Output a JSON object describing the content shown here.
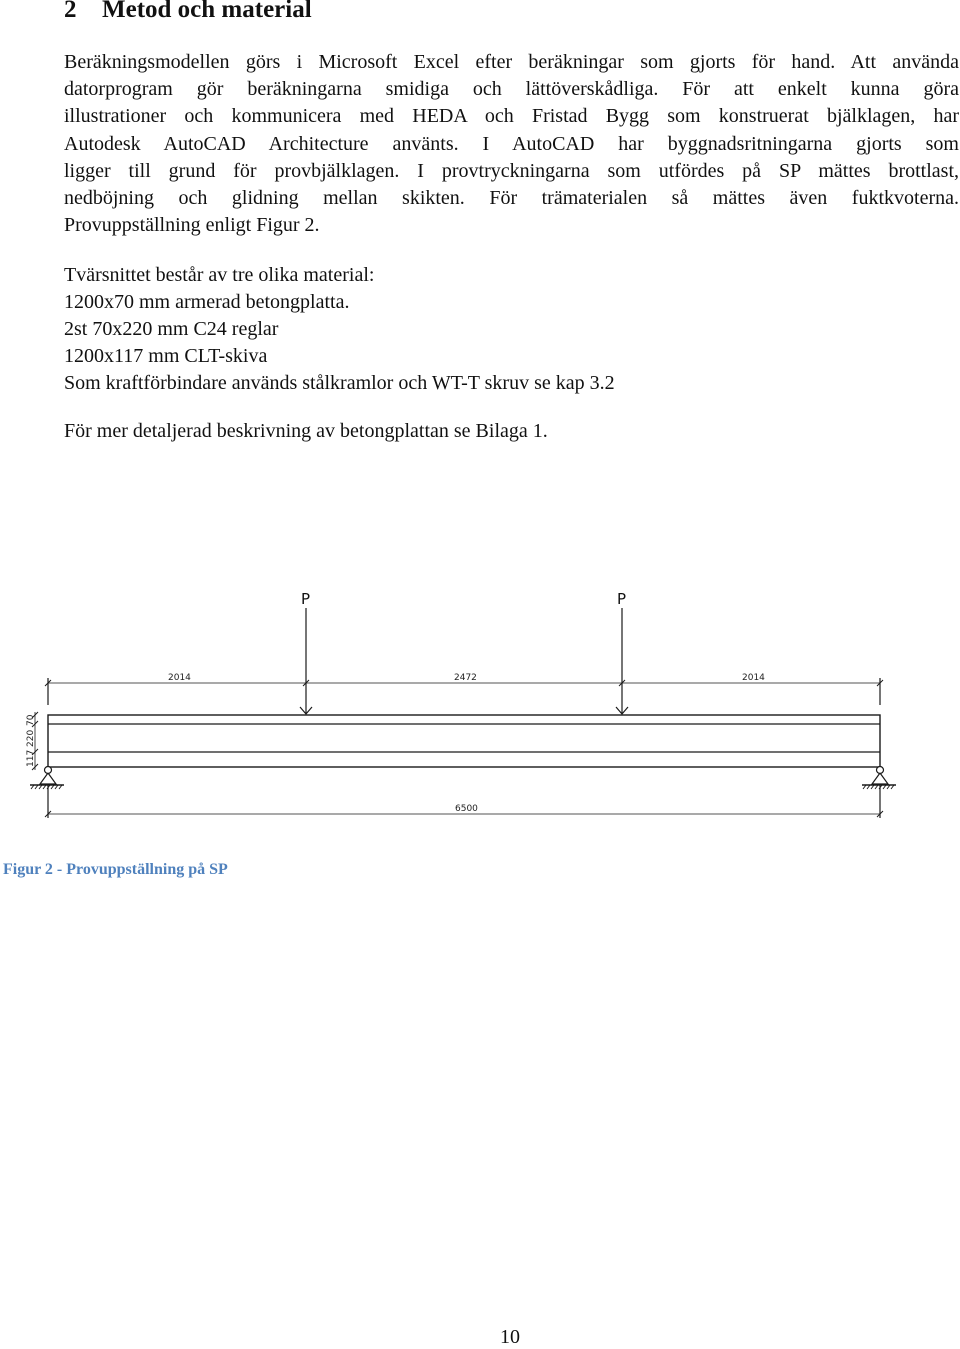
{
  "section": {
    "number": "2",
    "title": "Metod och material"
  },
  "paragraph1": {
    "lines": [
      "Beräkningsmodellen görs i Microsoft Excel efter beräkningar som gjorts för hand. Att använda",
      "datorprogram gör beräkningarna smidiga och lättöverskådliga. För att enkelt kunna göra",
      "illustrationer och kommunicera med HEDA och Fristad Bygg som konstruerat bjälklagen, har",
      "Autodesk AutoCAD Architecture använts. I AutoCAD har byggnadsritningarna gjorts som",
      "ligger till grund för provbjälklagen. I provtryckningarna som utfördes på SP mättes brottlast,",
      "nedböjning och glidning mellan skikten. För trämaterialen så mättes även fuktkvoterna.",
      "Provuppställning enligt Figur 2."
    ]
  },
  "materials": {
    "intro": "Tvärsnittet består av tre olika material:",
    "items": [
      "1200x70 mm armerad betongplatta.",
      "2st 70x220 mm C24 reglar",
      "1200x117 mm CLT-skiva",
      "Som kraftförbindare används stålkramlor och WT-T skruv se kap 3.2"
    ]
  },
  "reference": "För mer detaljerad beskrivning av betongplattan se Bilaga 1.",
  "figure": {
    "load_labels": [
      "P",
      "P"
    ],
    "span_dimensions": [
      "2014",
      "2472",
      "2014"
    ],
    "total_length": "6500",
    "layer_thicknesses": [
      "70",
      "220",
      "117"
    ],
    "caption": "Figur 2 - Provuppställning på SP"
  },
  "page_number": "10"
}
